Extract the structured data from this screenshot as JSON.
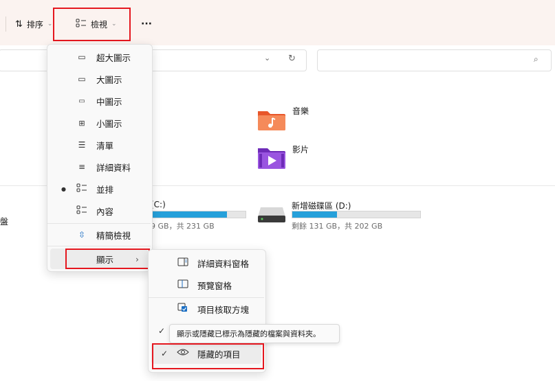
{
  "toolbar": {
    "sort_label": "排序",
    "view_label": "檢視",
    "more_label": "···"
  },
  "address_bar": {
    "value": ""
  },
  "search": {
    "placeholder": ""
  },
  "folders": [
    {
      "name": "音樂",
      "icon": "music-folder-icon",
      "color": "#f0643a"
    },
    {
      "name": "影片",
      "icon": "video-folder-icon",
      "color": "#8a45d6"
    }
  ],
  "drives": [
    {
      "label": "(C:)",
      "free": "9 GB，共 231 GB",
      "used_fraction": 0.8
    },
    {
      "label": "新增磁碟區 (D:)",
      "free": "剩餘 131 GB，共 202 GB",
      "used_fraction": 0.35
    }
  ],
  "left_stub_text": "盤",
  "view_menu": {
    "items": [
      {
        "label": "超大圖示",
        "icon": "monitor-icon"
      },
      {
        "label": "大圖示",
        "icon": "monitor-icon"
      },
      {
        "label": "中圖示",
        "icon": "monitor-icon"
      },
      {
        "label": "小圖示",
        "icon": "grid-icon"
      },
      {
        "label": "清單",
        "icon": "list-icon"
      },
      {
        "label": "詳細資料",
        "icon": "details-icon"
      },
      {
        "label": "並排",
        "icon": "tiles-icon",
        "selected": true
      },
      {
        "label": "內容",
        "icon": "content-icon"
      }
    ],
    "compact": {
      "label": "精簡檢視",
      "icon": "compact-icon"
    },
    "show": {
      "label": "顯示"
    }
  },
  "show_submenu": {
    "items": [
      {
        "label": "詳細資料窗格",
        "icon": "details-pane-icon"
      },
      {
        "label": "預覽窗格",
        "icon": "preview-pane-icon"
      },
      {
        "label": "項目核取方塊",
        "icon": "checkbox-icon"
      },
      {
        "label": "隱藏的項目",
        "icon": "eye-icon",
        "checked": true
      }
    ],
    "tooltip": "顯示或隱藏已標示為隱藏的檔案與資料夾。"
  },
  "colors": {
    "accent": "#26a0da",
    "highlight_box": "#e5161e"
  }
}
